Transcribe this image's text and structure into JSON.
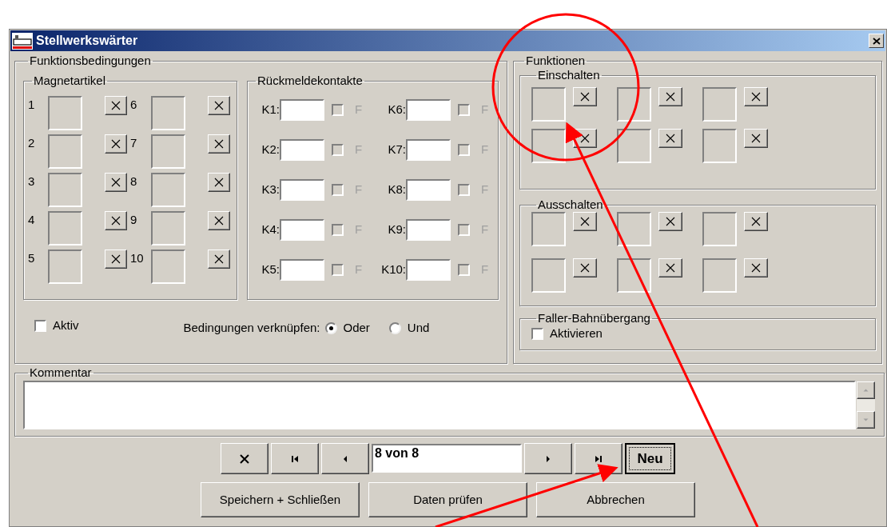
{
  "window": {
    "title": "Stellwerkswärter"
  },
  "conditions": {
    "title": "Funktionsbedingungen",
    "magnet_articles": {
      "title": "Magnetartikel",
      "items": [
        {
          "label": "1"
        },
        {
          "label": "2"
        },
        {
          "label": "3"
        },
        {
          "label": "4"
        },
        {
          "label": "5"
        },
        {
          "label": "6"
        },
        {
          "label": "7"
        },
        {
          "label": "8"
        },
        {
          "label": "9"
        },
        {
          "label": "10"
        }
      ]
    },
    "feedback_contacts": {
      "title": "Rückmeldekontakte",
      "items": [
        {
          "label": "K1:",
          "flag": "F",
          "checked": false,
          "disabled": true
        },
        {
          "label": "K2:",
          "flag": "F",
          "checked": false,
          "disabled": true
        },
        {
          "label": "K3:",
          "flag": "F",
          "checked": false,
          "disabled": true
        },
        {
          "label": "K4:",
          "flag": "F",
          "checked": false,
          "disabled": true
        },
        {
          "label": "K5:",
          "flag": "F",
          "checked": false,
          "disabled": true
        },
        {
          "label": "K6:",
          "flag": "F",
          "checked": false,
          "disabled": true
        },
        {
          "label": "K7:",
          "flag": "F",
          "checked": false,
          "disabled": true
        },
        {
          "label": "K8:",
          "flag": "F",
          "checked": false,
          "disabled": true
        },
        {
          "label": "K9:",
          "flag": "F",
          "checked": false,
          "disabled": true
        },
        {
          "label": "K10:",
          "flag": "F",
          "checked": false,
          "disabled": true
        }
      ]
    },
    "active": {
      "label": "Aktiv",
      "checked": false
    },
    "link": {
      "label": "Bedingungen verknüpfen:",
      "options": [
        {
          "label": "Oder",
          "selected": true
        },
        {
          "label": "Und",
          "selected": false
        }
      ]
    }
  },
  "functions": {
    "title": "Funktionen",
    "switch_on": {
      "title": "Einschalten"
    },
    "switch_off": {
      "title": "Ausschalten"
    },
    "crossing": {
      "title": "Faller-Bahnübergang",
      "label": "Aktivieren",
      "checked": false
    }
  },
  "comment": {
    "title": "Kommentar"
  },
  "navigation": {
    "record": "8 von 8",
    "new_button": {
      "label": "Neu",
      "focused": true
    }
  },
  "buttons": [
    "Speichern + Schließen",
    "Daten prüfen",
    "Abbrechen"
  ]
}
